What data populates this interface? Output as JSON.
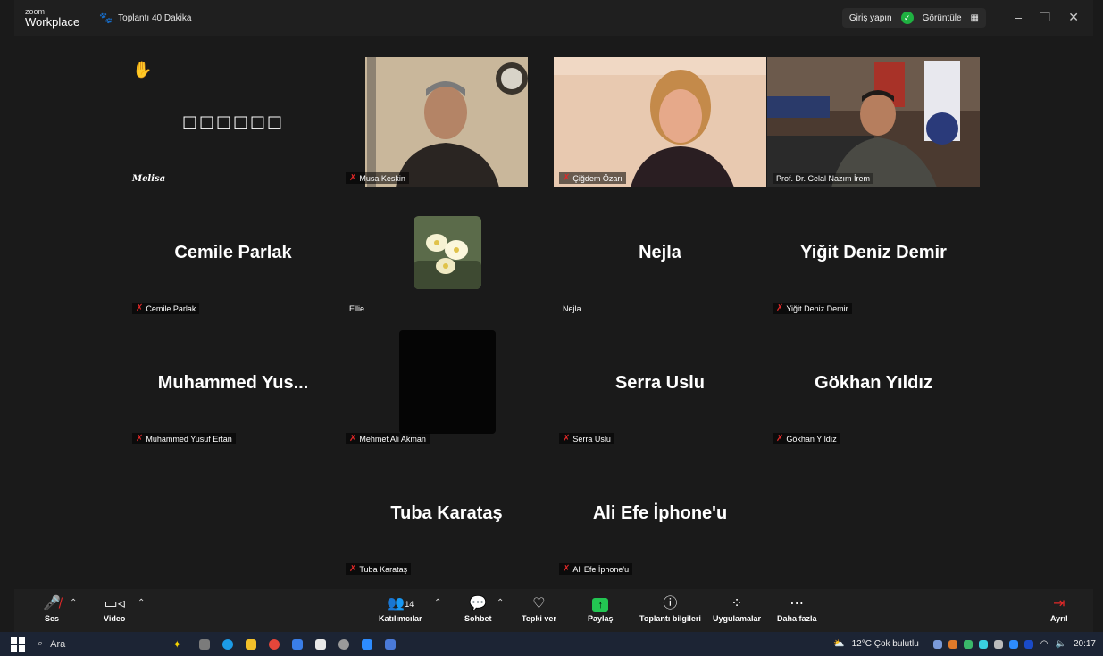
{
  "titlebar": {
    "brand_small": "zoom",
    "brand_big": "Workplace",
    "meeting_title": "Toplantı 40 Dakika",
    "signin": "Giriş yapın",
    "view": "Görüntüle"
  },
  "tiles": {
    "melisa": {
      "label": "Melisa",
      "placeholder": "□□□□□□"
    },
    "musa": {
      "label": "Musa Keskin"
    },
    "cigdem": {
      "label": "Çiğdem Özarı"
    },
    "celal": {
      "label": "Prof. Dr. Celal Nazım İrem"
    },
    "cemile": {
      "big": "Cemile Parlak",
      "label": "Cemile Parlak"
    },
    "ellie": {
      "label": "Ellie"
    },
    "nejla": {
      "big": "Nejla",
      "label": "Nejla"
    },
    "yigit": {
      "big": "Yiğit Deniz Demir",
      "label": "Yiğit Deniz Demir"
    },
    "muhammed": {
      "big": "Muhammed  Yus...",
      "label": "Muhammed Yusuf Ertan"
    },
    "mehmet": {
      "label": "Mehmet Ali Akman"
    },
    "serra": {
      "big": "Serra Uslu",
      "label": "Serra Uslu"
    },
    "gokhan": {
      "big": "Gökhan Yıldız",
      "label": "Gökhan Yıldız"
    },
    "tuba": {
      "big": "Tuba Karataş",
      "label": "Tuba Karataş"
    },
    "ali": {
      "big": "Ali Efe İphone'u",
      "label": "Ali Efe İphone'u"
    }
  },
  "toolbar": {
    "audio": "Ses",
    "video": "Video",
    "participants": "Katılımcılar",
    "participant_count": "14",
    "chat": "Sohbet",
    "react": "Tepki ver",
    "share": "Paylaş",
    "info": "Toplantı bilgileri",
    "apps": "Uygulamalar",
    "more": "Daha fazla",
    "leave": "Ayrıl"
  },
  "taskbar": {
    "search": "Ara",
    "weather": "12°C  Çok bulutlu",
    "time": "20:17"
  },
  "colors": {
    "active_speaker": "#23d959",
    "muted_mic": "#e02828",
    "share_green": "#23c552",
    "leave_red": "#e02828"
  }
}
